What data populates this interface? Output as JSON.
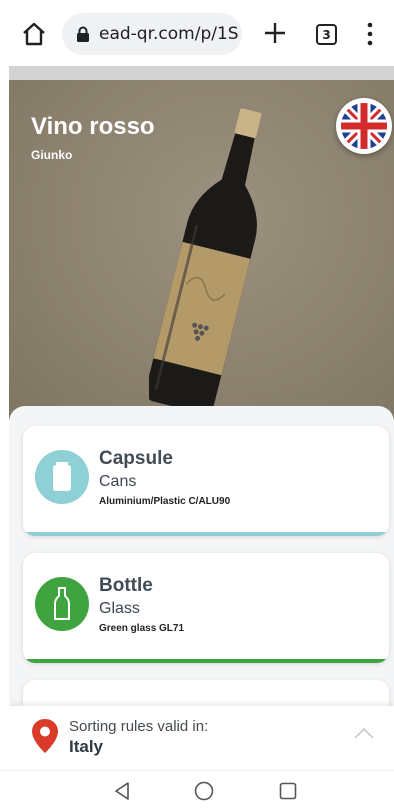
{
  "browser": {
    "url": "ead-qr.com/p/1S",
    "tab_count": "3"
  },
  "product": {
    "name": "Vino rosso",
    "brand": "Giunko",
    "language_flag": "uk-flag-icon"
  },
  "components": [
    {
      "title": "Capsule",
      "material": "Cans",
      "code": "Aluminium/Plastic C/ALU90",
      "icon": "can-icon",
      "color": "#8fcfd6"
    },
    {
      "title": "Bottle",
      "material": "Glass",
      "code": "Green glass GL71",
      "icon": "bottle-icon",
      "color": "#3fa33f"
    }
  ],
  "footer": {
    "sorting_label": "Sorting rules valid in:",
    "country": "Italy"
  },
  "colors": {
    "accent_red": "#d93a2a",
    "hero_background": "#8e8472"
  }
}
